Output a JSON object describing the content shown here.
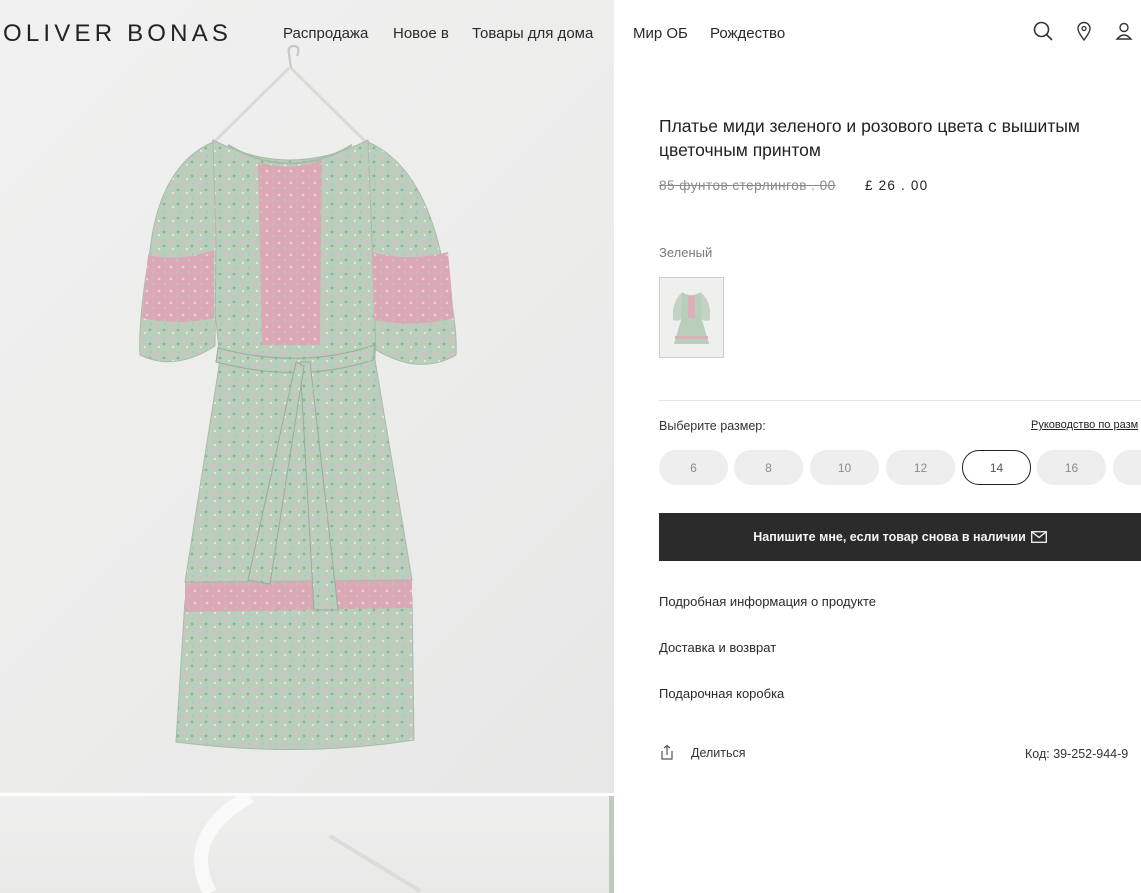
{
  "header": {
    "logo": "OLIVER BONAS",
    "nav": [
      "Распродажа",
      "Новое в",
      "Товары для дома",
      "Мир ОБ",
      "Рождество"
    ],
    "icons": [
      "search-icon",
      "location-pin-icon",
      "account-icon"
    ]
  },
  "product": {
    "title_line1": "Платье миди зеленого и розового цвета с вышитым",
    "title_line2": "цветочным принтом",
    "price_old": "85 фунтов стерлингов . 00",
    "price_new": "£ 26 . 00",
    "color_label": "Зеленый",
    "size_label": "Выберите размер:",
    "size_guide": "Руководство по разм",
    "sizes": [
      "6",
      "8",
      "10",
      "12",
      "14",
      "16"
    ],
    "selected_size": "14",
    "notify_label": "Напишите мне, если товар снова в наличии",
    "accordions": [
      "Подробная информация о продукте",
      "Доставка и возврат",
      "Подарочная коробка"
    ],
    "share_label": "Делиться",
    "code": "Код: 39-252-944-9"
  },
  "colors": {
    "dress_green": "#b7cdbb",
    "dress_pink": "#dca8b6",
    "button_dark": "#2b2b2b",
    "size_pill": "#eeeeee"
  }
}
